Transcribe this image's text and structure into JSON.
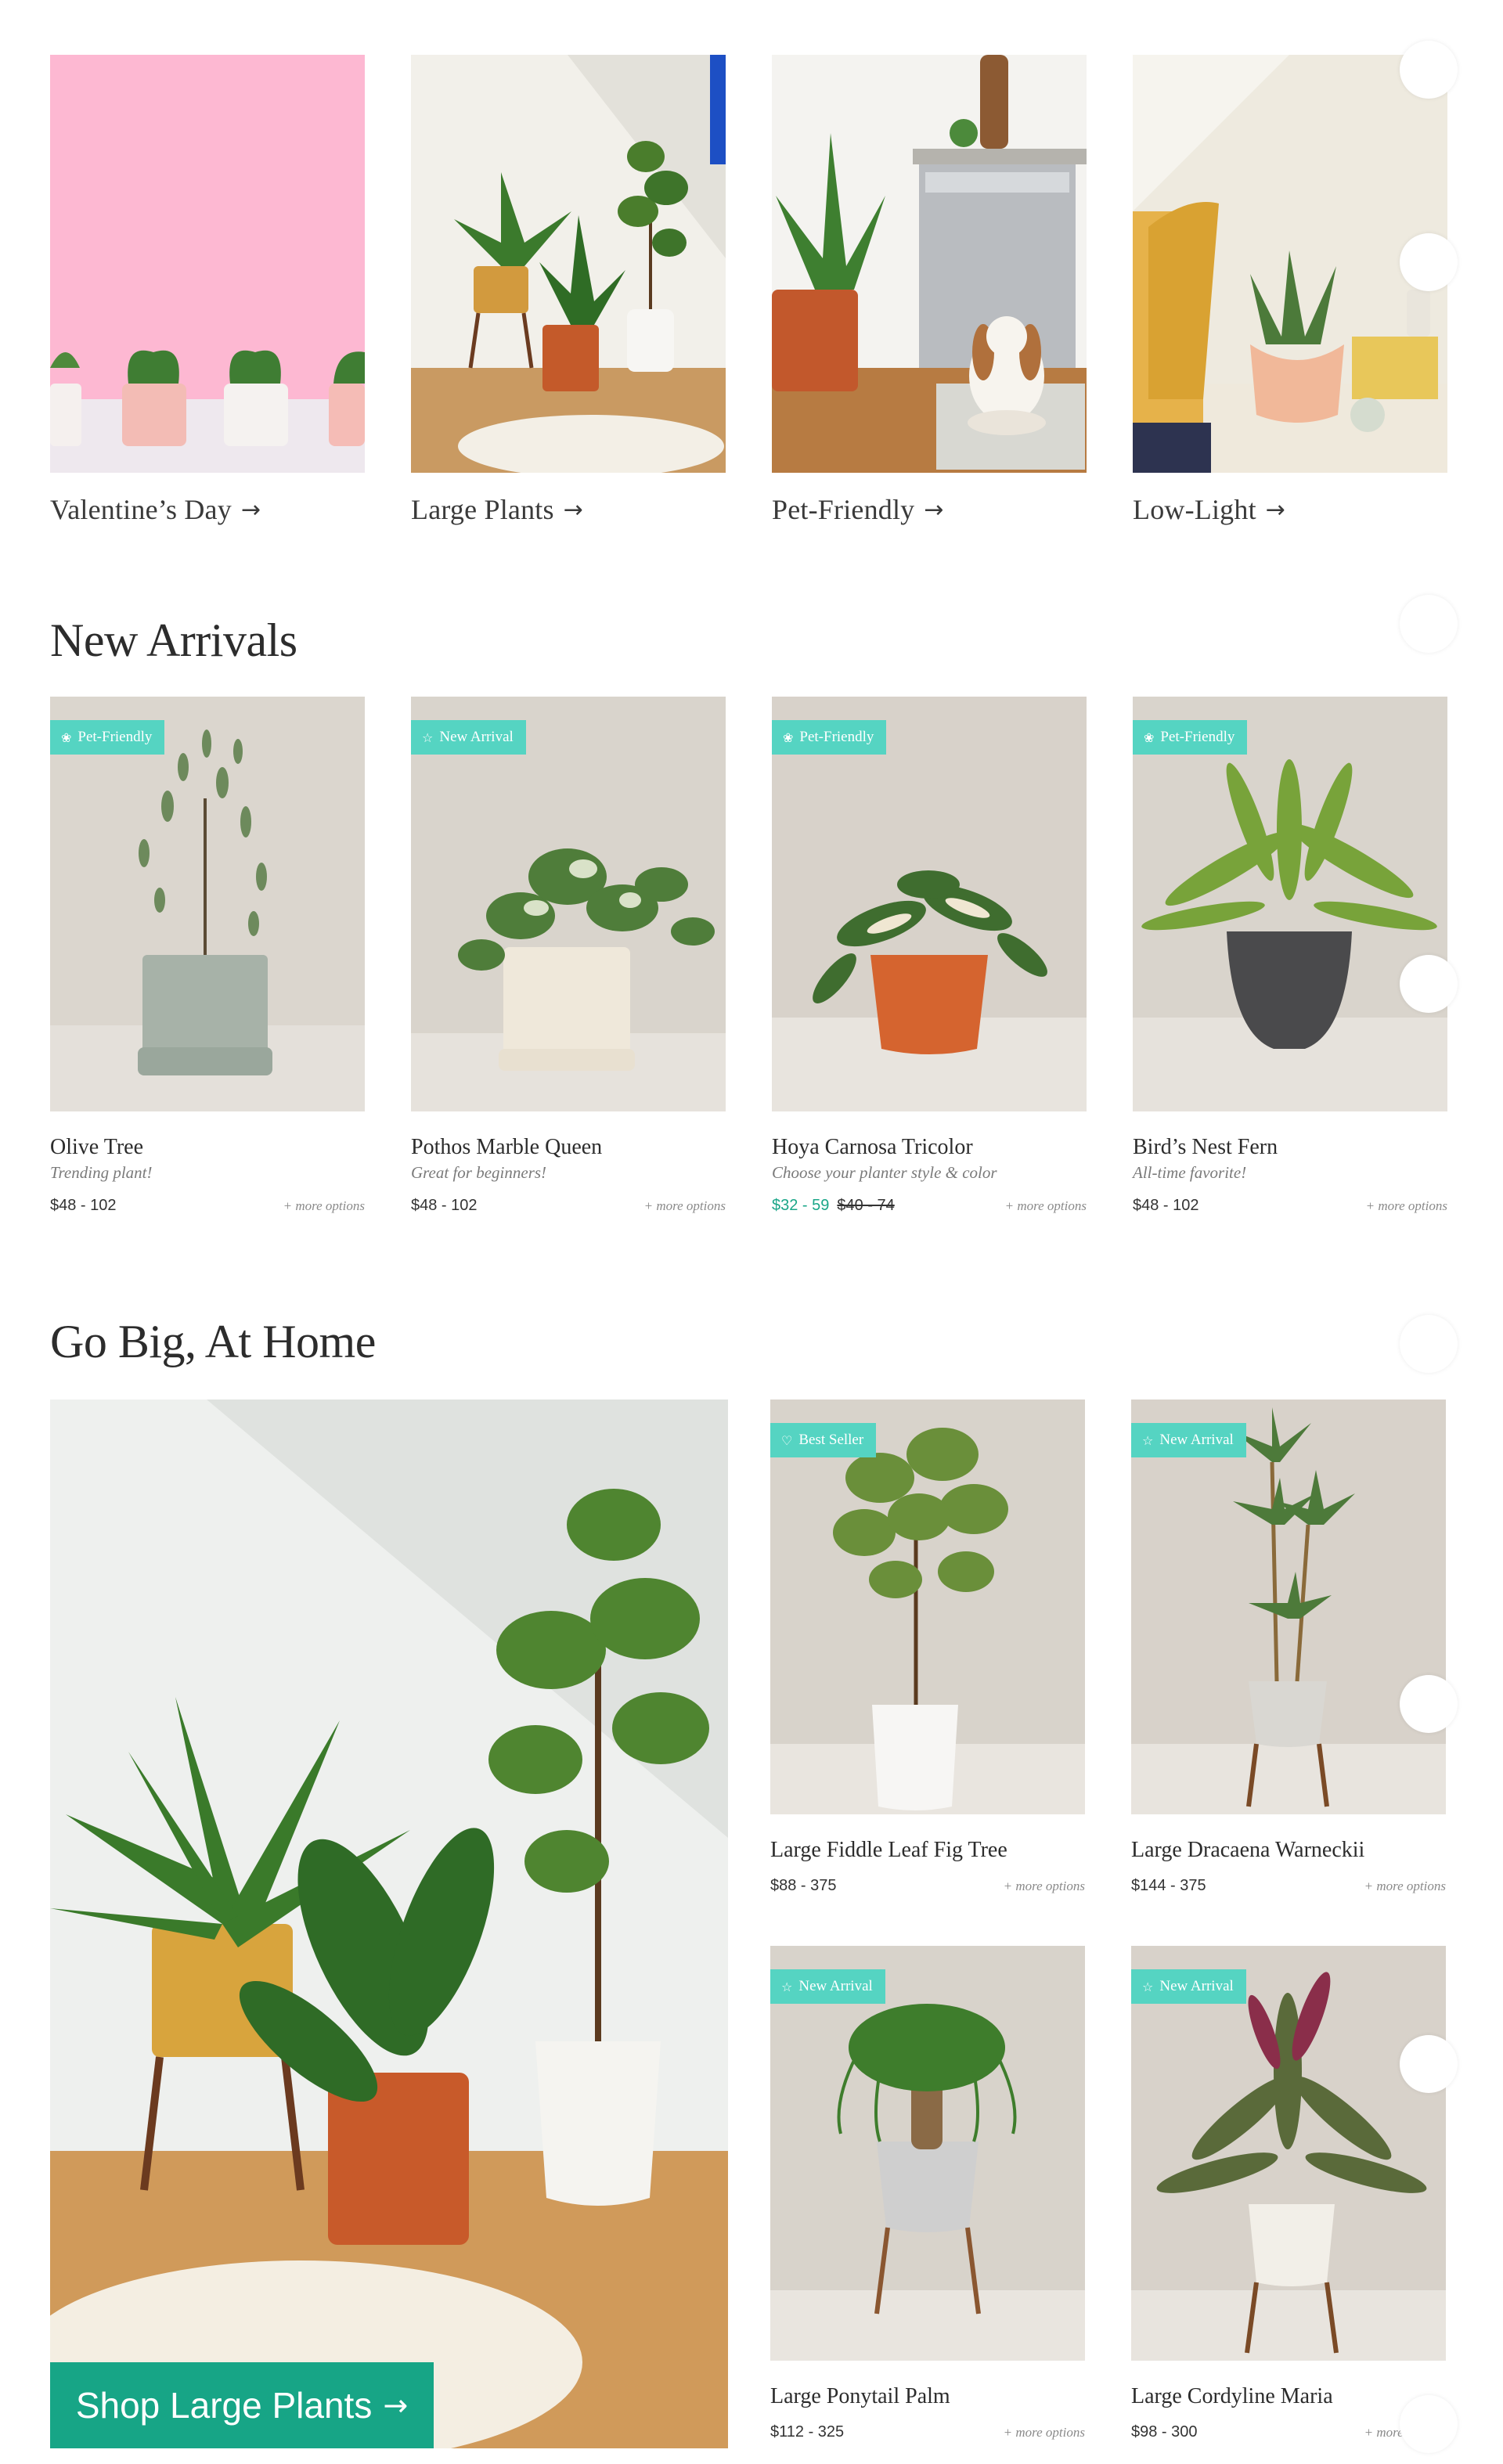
{
  "categories": [
    {
      "label": "Valentine’s Day",
      "arrow": "→"
    },
    {
      "label": "Large Plants",
      "arrow": "→"
    },
    {
      "label": "Pet-Friendly",
      "arrow": "→"
    },
    {
      "label": "Low-Light",
      "arrow": "→"
    }
  ],
  "new_arrivals": {
    "title": "New Arrivals",
    "items": [
      {
        "badge": "Pet-Friendly",
        "badge_icon": "paw-icon",
        "name": "Olive Tree",
        "subtitle": "Trending plant!",
        "price": "$48 - 102",
        "more": "+ more options"
      },
      {
        "badge": "New Arrival",
        "badge_icon": "star-icon",
        "name": "Pothos Marble Queen",
        "subtitle": "Great for beginners!",
        "price": "$48 - 102",
        "more": "+ more options"
      },
      {
        "badge": "Pet-Friendly",
        "badge_icon": "paw-icon",
        "name": "Hoya Carnosa Tricolor",
        "subtitle": "Choose your planter style & color",
        "price": "$32 - 59",
        "price_old": "$40 - 74",
        "more": "+ more options"
      },
      {
        "badge": "Pet-Friendly",
        "badge_icon": "paw-icon",
        "name": "Bird’s Nest Fern",
        "subtitle": "All-time favorite!",
        "price": "$48 - 102",
        "more": "+ more options"
      }
    ]
  },
  "go_big": {
    "title": "Go Big, At Home",
    "hero_button": "Shop Large Plants",
    "hero_arrow": "→",
    "items": [
      {
        "badge": "Best Seller",
        "badge_icon": "heart-icon",
        "name": "Large Fiddle Leaf Fig Tree",
        "price": "$88 - 375",
        "more": "+ more options"
      },
      {
        "badge": "New Arrival",
        "badge_icon": "star-icon",
        "name": "Large Dracaena Warneckii",
        "price": "$144 - 375",
        "more": "+ more options"
      },
      {
        "badge": "New Arrival",
        "badge_icon": "star-icon",
        "name": "Large Ponytail Palm",
        "price": "$112 - 325",
        "more": "+ more options"
      },
      {
        "badge": "New Arrival",
        "badge_icon": "star-icon",
        "name": "Large Cordyline Maria",
        "price": "$98 - 300",
        "more": "+ more options"
      }
    ]
  },
  "colors": {
    "badge": "#55d4c2",
    "cta": "#17a586",
    "sale_price": "#1aa688"
  }
}
